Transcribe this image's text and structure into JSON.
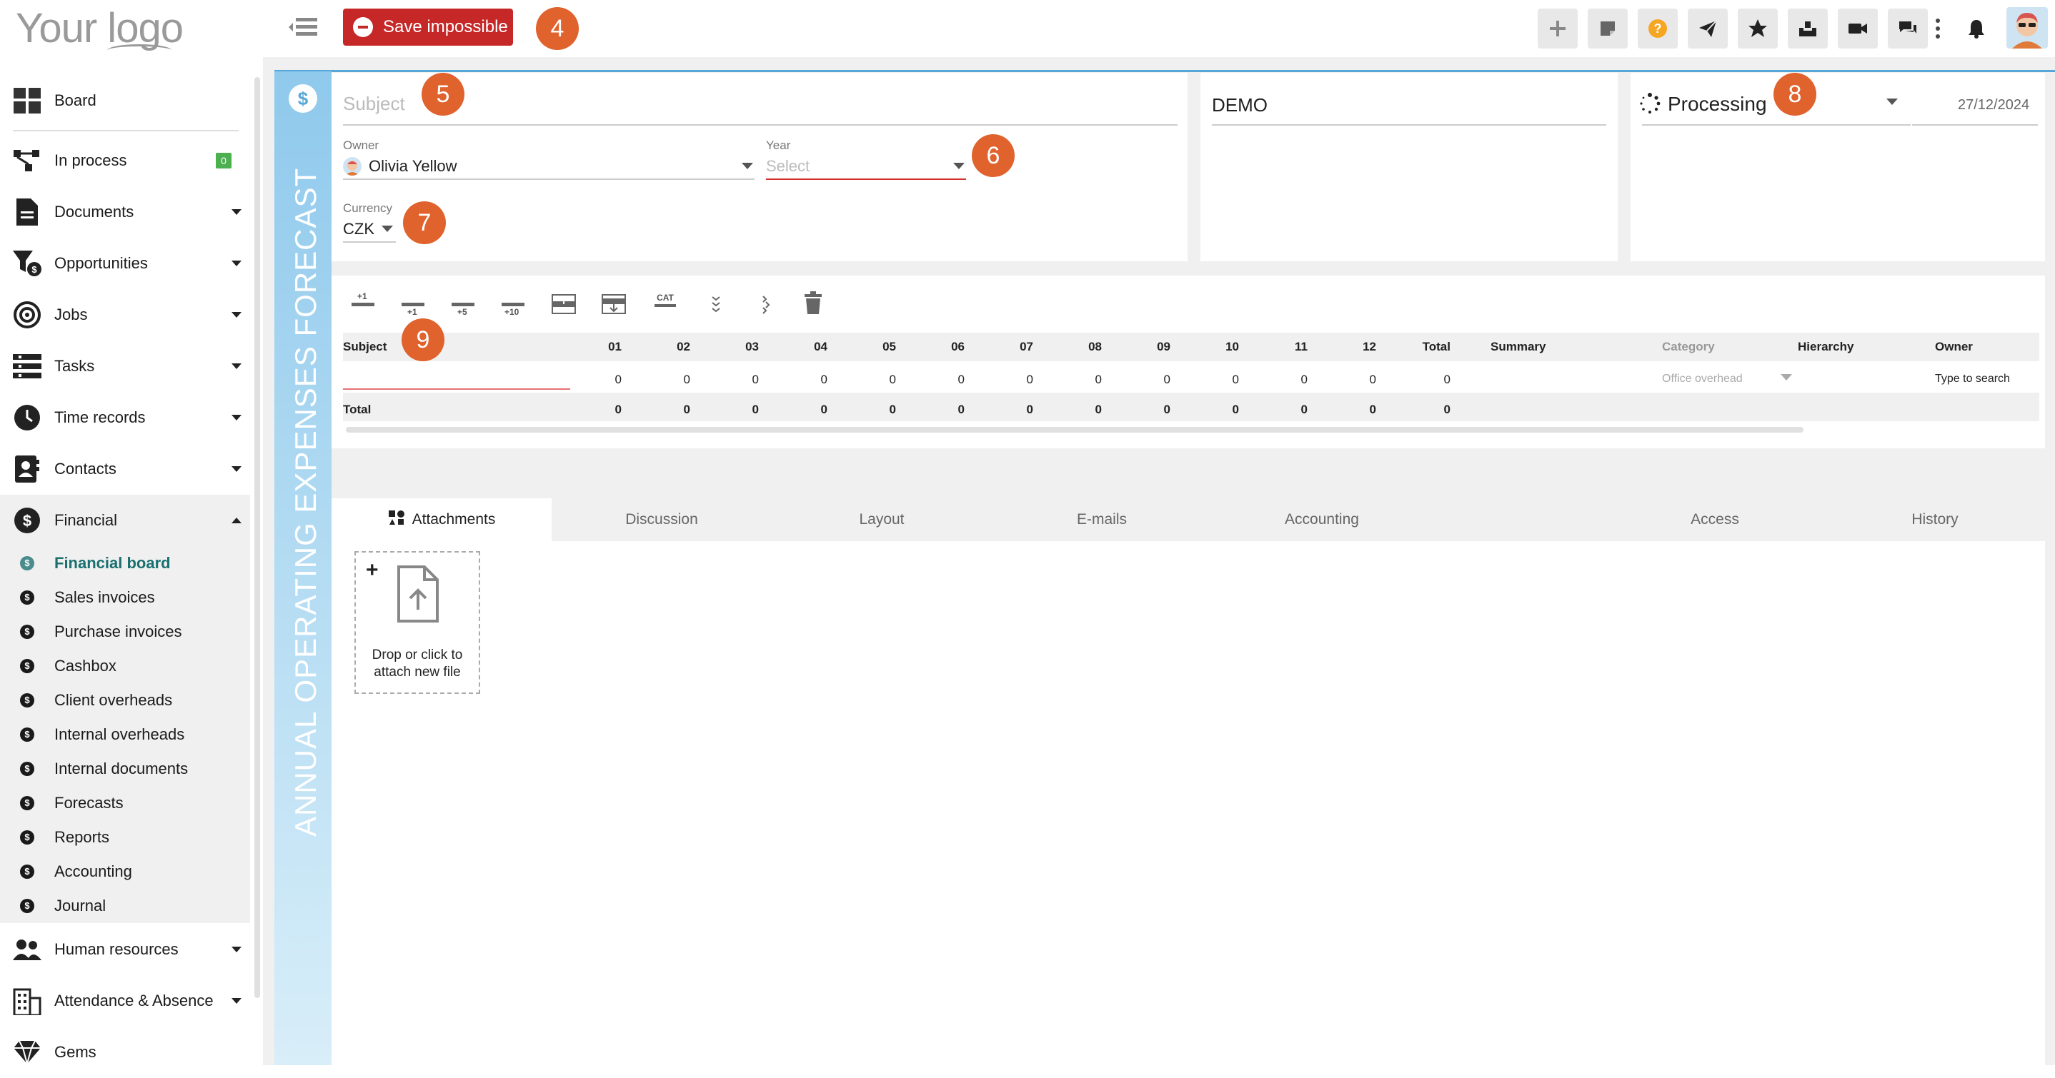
{
  "header": {
    "logo_text": "Your logo",
    "save_label": "Save impossible",
    "badges": {
      "b4": "4",
      "b5": "5",
      "b6": "6",
      "b7": "7",
      "b8": "8",
      "b9": "9"
    }
  },
  "sidebar": {
    "items": [
      {
        "label": "Board"
      },
      {
        "label": "In process",
        "count": "0"
      },
      {
        "label": "Documents"
      },
      {
        "label": "Opportunities"
      },
      {
        "label": "Jobs"
      },
      {
        "label": "Tasks"
      },
      {
        "label": "Time records"
      },
      {
        "label": "Contacts"
      },
      {
        "label": "Financial"
      }
    ],
    "financial_sub": [
      "Financial board",
      "Sales invoices",
      "Purchase invoices",
      "Cashbox",
      "Client overheads",
      "Internal overheads",
      "Internal documents",
      "Forecasts",
      "Reports",
      "Accounting",
      "Journal"
    ],
    "bottom_items": [
      {
        "label": "Human resources"
      },
      {
        "label": "Attendance & Absence"
      },
      {
        "label": "Gems"
      }
    ]
  },
  "form": {
    "vertical_title": "ANNUAL OPERATING EXPENSES FORECAST",
    "subject_placeholder": "Subject",
    "owner_label": "Owner",
    "owner_value": "Olivia Yellow",
    "year_label": "Year",
    "year_placeholder": "Select",
    "currency_label": "Currency",
    "currency_value": "CZK",
    "company_value": "DEMO",
    "status_value": "Processing",
    "date_value": "27/12/2024"
  },
  "grid": {
    "toolbar": {
      "plus1": "+1",
      "minus1": "+1",
      "minus5": "+5",
      "minus10": "+10",
      "cat": "CAT"
    },
    "headers": [
      "Subject",
      "01",
      "02",
      "03",
      "04",
      "05",
      "06",
      "07",
      "08",
      "09",
      "10",
      "11",
      "12",
      "Total",
      "Summary",
      "Category",
      "Hierarchy",
      "Owner"
    ],
    "row_values": [
      "0",
      "0",
      "0",
      "0",
      "0",
      "0",
      "0",
      "0",
      "0",
      "0",
      "0",
      "0",
      "0"
    ],
    "category_placeholder": "Office overhead",
    "owner_placeholder": "Type to search",
    "total_label": "Total",
    "total_values": [
      "0",
      "0",
      "0",
      "0",
      "0",
      "0",
      "0",
      "0",
      "0",
      "0",
      "0",
      "0",
      "0"
    ]
  },
  "tabs": [
    "Attachments",
    "Discussion",
    "Layout",
    "E-mails",
    "Accounting",
    "Access",
    "History"
  ],
  "attachments": {
    "drop_text_1": "Drop or click to",
    "drop_text_2": "attach new file"
  },
  "colors": {
    "save_red": "#c62828",
    "badge_orange": "#e0622d",
    "band_blue": "#8fc9ec",
    "accent_teal": "#1a6f6f"
  }
}
